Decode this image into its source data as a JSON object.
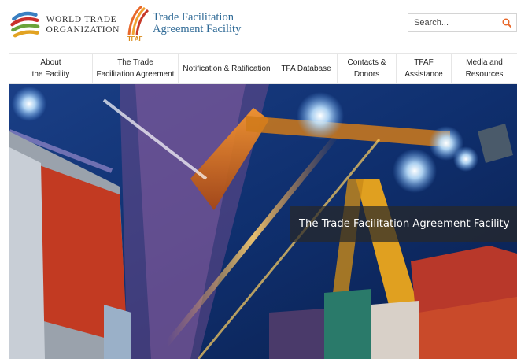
{
  "branding": {
    "wto_line1": "WORLD TRADE",
    "wto_line2": "ORGANIZATION",
    "tfaf_line1": "Trade Facilitation",
    "tfaf_line2": "Agreement Facility",
    "tfaf_small": "TFAF"
  },
  "search": {
    "placeholder": "Search...",
    "icon": "search-icon"
  },
  "nav": {
    "items": [
      {
        "label": "About\nthe Facility"
      },
      {
        "label": "The Trade\nFacilitation Agreement"
      },
      {
        "label": "Notification & Ratification"
      },
      {
        "label": "TFA Database"
      },
      {
        "label": "Contacts &\nDonors"
      },
      {
        "label": "TFAF\nAssistance"
      },
      {
        "label": "Media and\nResources"
      }
    ]
  },
  "hero": {
    "caption": "The Trade Facilitation Agreement Facility"
  },
  "colors": {
    "accent": "#e8692b",
    "tfaf_blue": "#2f6a96",
    "caption_bg": "#2b2b2b"
  }
}
